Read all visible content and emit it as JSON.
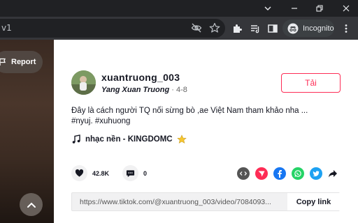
{
  "browser": {
    "url_fragment": "v1",
    "incognito_label": "Incognito",
    "window_controls": [
      "chevron-down-icon",
      "minimize-icon",
      "restore-icon",
      "close-icon"
    ]
  },
  "video": {
    "report_label": "Report"
  },
  "post": {
    "username": "xuantruong_003",
    "nickname": "Yang Xuan Truong",
    "separator": "·",
    "date": "4-8",
    "follow_label": "Tải",
    "description": "Đây là cách người TQ nối sừng bò ,ae Việt Nam tham khảo nha ...",
    "hashtags": "#nyuj. #xuhuong",
    "music": "nhạc nền - KINGDOMC",
    "likes": "42.8K",
    "comments": "0",
    "share_icons": [
      "embed-icon",
      "send-icon",
      "facebook-icon",
      "whatsapp-icon",
      "twitter-icon",
      "share-arrow-icon"
    ],
    "link": "https://www.tiktok.com/@xuantruong_003/video/7084093...",
    "copy_label": "Copy link"
  },
  "colors": {
    "accent": "#fe2c55",
    "chrome_dark": "#202124",
    "chrome_toolbar": "#35363a",
    "facebook": "#1877f2",
    "whatsapp": "#25d366",
    "twitter": "#1da1f2"
  }
}
